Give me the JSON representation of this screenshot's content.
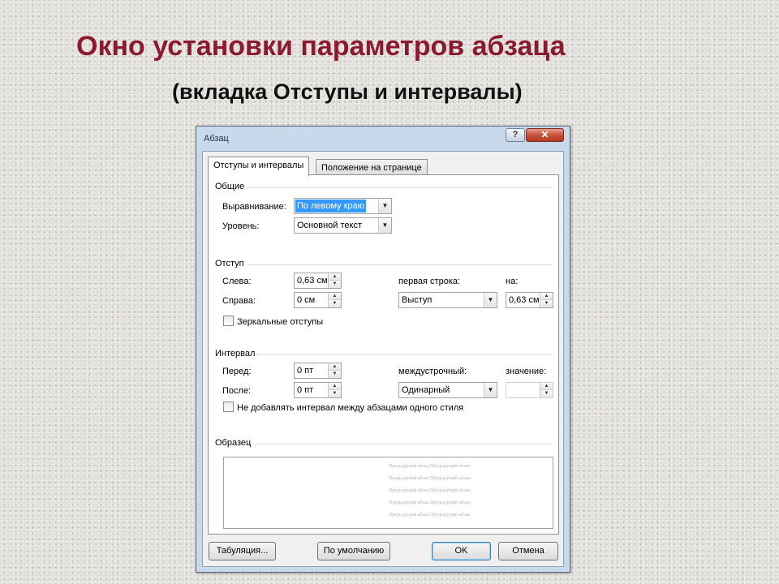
{
  "slide": {
    "title": "Окно установки параметров абзаца",
    "subtitle": "(вкладка Отступы и интервалы)"
  },
  "dialog": {
    "title": "Абзац",
    "help_label": "?",
    "close_label": "✕",
    "tabs": [
      "Отступы и интервалы",
      "Положение на странице"
    ],
    "active_tab": 0,
    "general": {
      "section_label": "Общие",
      "alignment_label": "Выравнивание:",
      "alignment_value": "По левому краю",
      "level_label": "Уровень:",
      "level_value": "Основной текст"
    },
    "indent": {
      "section_label": "Отступ",
      "left_label": "Слева:",
      "left_value": "0,63 см",
      "right_label": "Справа:",
      "right_value": "0 см",
      "first_line_label": "первая строка:",
      "first_line_value": "Выступ",
      "by_label": "на:",
      "by_value": "0,63 см",
      "mirror_label": "Зеркальные отступы",
      "mirror_checked": false
    },
    "spacing": {
      "section_label": "Интервал",
      "before_label": "Перед:",
      "before_value": "0 пт",
      "after_label": "После:",
      "after_value": "0 пт",
      "line_spacing_label": "междустрочный:",
      "line_spacing_value": "Одинарный",
      "at_label": "значение:",
      "at_value": "",
      "dont_add_label": "Не добавлять интервал между абзацами одного стиля",
      "dont_add_checked": false
    },
    "preview": {
      "section_label": "Образец",
      "lines": [
        "Предыдущий абзац Предыдущий абзац",
        "Предыдущий абзац Предыдущий абзац",
        "Предыдущий абзац Предыдущий абзац",
        "Предыдущий абзац Предыдущий абзац",
        "Предыдущий абзац Предыдущий абзац"
      ]
    },
    "buttons": {
      "tabs": "Табуляция...",
      "default": "По умолчанию",
      "ok": "OK",
      "cancel": "Отмена"
    }
  },
  "colors": {
    "title": "#8b1a2e",
    "dialog_frame": "#c9d9ec",
    "selection": "#3399ff"
  }
}
